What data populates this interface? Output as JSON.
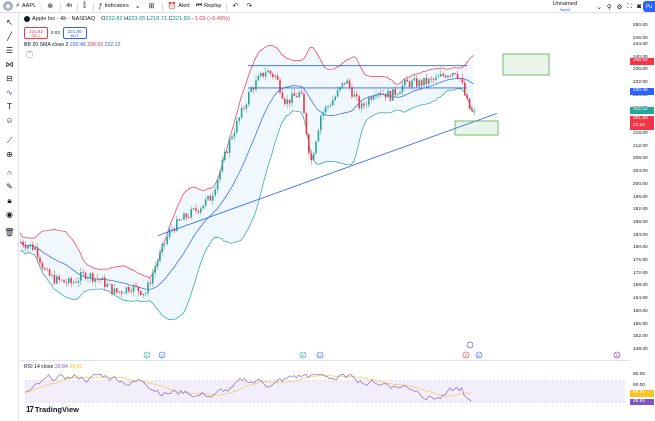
{
  "toolbar": {
    "symbol": "AAPL",
    "interval": "4h",
    "indicators_label": "Indicators",
    "alert_label": "Alert",
    "replay_label": "Replay",
    "layout_name": "Unnamed",
    "layout_status": "Saved",
    "publish_label": "Pu"
  },
  "legend": {
    "title": "Apple Inc · 4h · NASDAQ",
    "open_label": "O",
    "open": "222.82",
    "high_label": "H",
    "high": "223.05",
    "low_label": "L",
    "low": "218.71",
    "close_label": "C",
    "close": "221.83",
    "change": "−1.09 (−0.49%)",
    "sell_price": "221.82",
    "sell_label": "SELL",
    "spread": "0.03",
    "buy_price": "221.85",
    "buy_label": "BUY",
    "collapse_glyph": "^"
  },
  "bb_legend": {
    "label": "BB 20 SMA close 2",
    "basis": "230.48",
    "upper": "238.83",
    "lower": "222.12"
  },
  "rsi_legend": {
    "label": "RSI 14 close",
    "rsi": "29.84",
    "rsi_ma": "45.41"
  },
  "price_axis": {
    "ticks": [
      "250.00",
      "246.00",
      "244.00",
      "240.00",
      "236.00",
      "232.00",
      "228.00",
      "224.00",
      "220.00",
      "216.00",
      "212.00",
      "208.00",
      "204.00",
      "200.00",
      "196.00",
      "192.00",
      "188.00",
      "184.00",
      "180.00",
      "176.00",
      "172.00",
      "168.00",
      "164.00",
      "160.00",
      "156.00",
      "152.00",
      "148.00"
    ],
    "tags": [
      {
        "text": "238.83",
        "color": "#f23645"
      },
      {
        "text": "230.48",
        "color": "#2962ff"
      },
      {
        "text": "222.12",
        "color": "#26a69a"
      },
      {
        "text": "221.83",
        "color": "#f23645"
      },
      {
        "text": "21:20",
        "color": "#f23645"
      }
    ]
  },
  "rsi_axis": {
    "ticks": [
      "80.00",
      "60.00",
      "40.00"
    ],
    "tags": [
      {
        "text": "45.41",
        "color": "#f7c325"
      },
      {
        "text": "29.84",
        "color": "#7e57c2"
      }
    ]
  },
  "chart_colors": {
    "up": "#26a69a",
    "down": "#f23645",
    "bb_basis": "#2962ff",
    "bb_upper": "#f23645",
    "bb_lower": "#26a69a",
    "bb_fill": "#e3f2fd",
    "trendline": "#2962ff",
    "green_box": "#4caf50",
    "rsi_line": "#7e57c2",
    "rsi_ma": "#f7c325",
    "rsi_bg": "#f3eefb"
  },
  "icons": {
    "sidebar": [
      "crosshair-icon",
      "trendline-tool-icon",
      "fib-tool-icon",
      "pattern-tool-icon",
      "projection-tool-icon",
      "brush-tool-icon",
      "text-tool-icon",
      "emoji-icon",
      "ruler-icon",
      "zoom-icon",
      "magnet-icon",
      "lock-draw-icon",
      "lock-icon",
      "visibility-icon",
      "trash-icon"
    ]
  },
  "branding": {
    "logo_text": "TradingView"
  },
  "markers": {
    "earnings": "E",
    "dividend": "D",
    "split": "S"
  }
}
